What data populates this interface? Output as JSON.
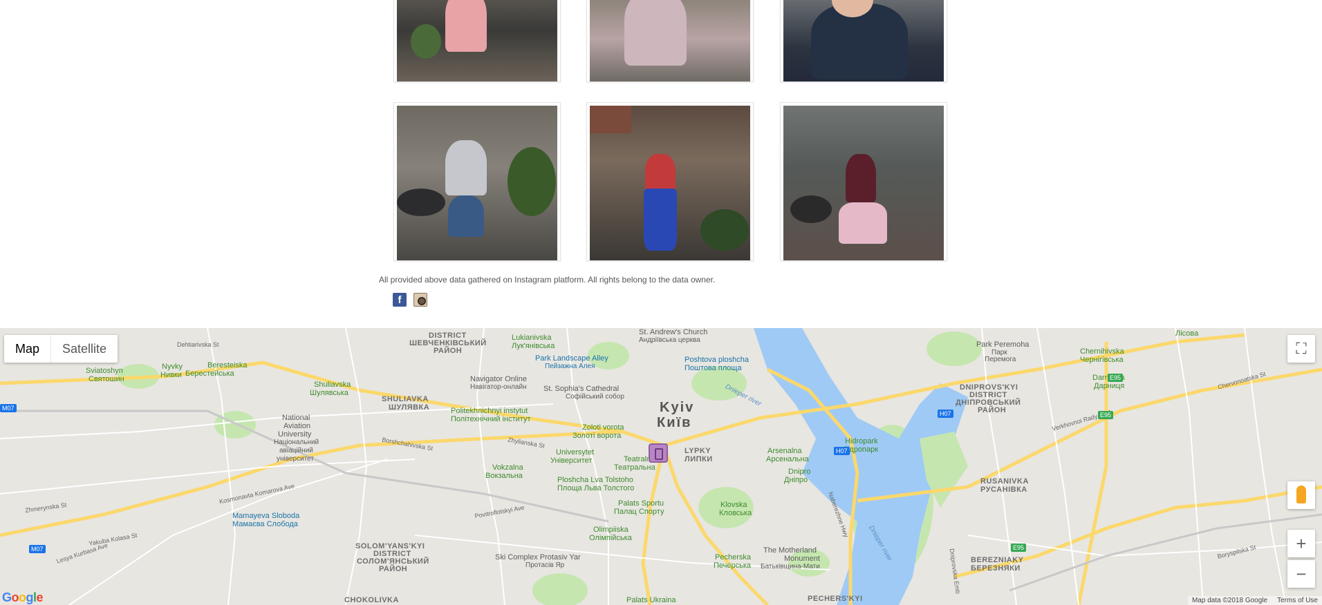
{
  "disclaimer": "All provided above data gathered on Instagram platform. All rights belong to the data owner.",
  "social": {
    "facebook_glyph": "f"
  },
  "map": {
    "type_map": "Map",
    "type_satellite": "Satellite",
    "attribution": "Map data ©2018 Google",
    "terms": "Terms of Use",
    "logo": [
      "G",
      "o",
      "o",
      "g",
      "l",
      "e"
    ],
    "labels": {
      "shevchenkivskyi_1": "DISTRICT",
      "shevchenkivskyi_2": "ШЕВЧЕНКІВСЬКИЙ",
      "shevchenkivskyi_3": "РАЙОН",
      "lukianivska_en": "Lukianivska",
      "lukianivska_ua": "Лук'янівська",
      "st_andrews_en": "St. Andrew's Church",
      "st_andrews_ua": "Андріївська церква",
      "park_landscape_en": "Park Landscape Alley",
      "park_landscape_ua": "Пейзажна Алея",
      "poshtova_en": "Poshtova ploshcha",
      "poshtova_ua": "Поштова площа",
      "park_peremoha_en": "Park Peremoha",
      "park_peremoha_ua1": "Парк",
      "park_peremoha_ua2": "Перемога",
      "chernihivska_en": "Chernihivska",
      "chernihivska_ua": "Чернігівська",
      "lisova_ua": "Лісова",
      "darnytsia_en": "Darnytsia",
      "darnytsia_ua": "Дарниця",
      "dniprovskyi_1": "DNIPROVS'KYI",
      "dniprovskyi_2": "DISTRICT",
      "dniprovskyi_3": "ДНІПРОВСЬКИЙ",
      "dniprovskyi_4": "РАЙОН",
      "sviatoshyn_en": "Sviatoshyn",
      "sviatoshyn_ua": "Святошин",
      "nyvky_en": "Nyvky",
      "nyvky_ua": "Нивки",
      "beresteiska_en": "Beresteiska",
      "beresteiska_ua": "Берестейська",
      "shuliavska_en": "Shuliavska",
      "shuliavska_ua": "Шулявська",
      "navigator_en": "Navigator Online",
      "navigator_ua": "Навігатор-онлайн",
      "st_sophia_en": "St. Sophia's Cathedral",
      "st_sophia_ua": "Софійський собор",
      "shuliavka_en": "SHULIAVKA",
      "shuliavka_ua": "ШУЛЯВКА",
      "polytech_en": "Politekhnichnyi instytut",
      "polytech_ua": "Політехнічний інститут",
      "kyiv_en": "Kyiv",
      "kyiv_ua": "Київ",
      "zoloti_en": "Zoloti vorota",
      "zoloti_ua": "Золоті ворота",
      "lypky_en": "LYPKY",
      "lypky_ua": "ЛИПКИ",
      "national_aviation_1": "National",
      "national_aviation_2": "Aviation",
      "national_aviation_3": "University",
      "national_aviation_4": "Національний",
      "national_aviation_5": "авіаційний",
      "national_aviation_6": "університет",
      "universytet_en": "Universytet",
      "universytet_ua": "Університет",
      "teatralna_en": "Teatralna",
      "teatralna_ua": "Театральна",
      "arsenalna_en": "Arsenalna",
      "arsenalna_ua": "Арсенальна",
      "hidropark_en": "Hidropark",
      "hidropark_ua": "Гідропарк",
      "vokzalna_en": "Vokzalna",
      "vokzalna_ua": "Вокзальна",
      "ploshcha_lva_en": "Ploshcha Lva Tolstoho",
      "ploshcha_lva_ua": "Площа Льва Толстого",
      "dnipro_en": "Dnipro",
      "dnipro_ua": "Дніпро",
      "rusanivka_en": "RUSANIVKA",
      "rusanivka_ua": "РУСАНІВКА",
      "mamayeva_en": "Mamayeva Sloboda",
      "mamayeva_ua": "Мамаєва Слобода",
      "palats_sportu_en": "Palats Sportu",
      "palats_sportu_ua": "Палац Спорту",
      "klovska_en": "Klovska",
      "klovska_ua": "Кловська",
      "olimpiiska_en": "Olimpiiska",
      "olimpiiska_ua": "Олімпійська",
      "solomianskyi_1": "SOLOM'YANS'KYI",
      "solomianskyi_2": "DISTRICT",
      "solomianskyi_3": "СОЛОМ'ЯНСЬКИЙ",
      "solomianskyi_4": "РАЙОН",
      "motherland_1": "The Motherland",
      "motherland_2": "Monument",
      "motherland_3": "Батьківщина-Мати",
      "pecherska_en": "Pecherska",
      "pecherska_ua": "Печерська",
      "ski_complex_en": "Ski Complex Protasiv Yar",
      "ski_complex_ua": "Протасів Яр",
      "berezniaky_en": "BEREZNIAKY",
      "berezniaky_ua": "БЕРЕЗНЯКИ",
      "chokolivka": "CHOKOLIVKA",
      "pecherskyi": "PECHERS'KYI",
      "palats_ukraina": "Palats Ukraina",
      "dnieper_river_1": "Dnieper river",
      "dnieper_river_2": "Dnieper river",
      "naberezhne": "Naberezhne Hwy",
      "dniprovska_emb": "Dniprovska Emb",
      "hw_m07a": "M07",
      "hw_m07b": "M07",
      "hw_h07a": "H07",
      "hw_h07b": "H07",
      "hw_e95a": "E95",
      "hw_e95b": "E95",
      "hw_e95c": "E95",
      "road_dehtiarivska": "Dehtiarivska St",
      "road_borshchahivska": "Borshchahivska St",
      "road_zhylianska": "Zhylianska St",
      "road_zhmerynska": "Zhmerynska St",
      "road_kosmonavta": "Kosmonavta Komarova Ave",
      "road_lesia": "Lesya Kurbasa Ave",
      "road_verkhovnoi": "Verkhovnoi Rady Blvd",
      "road_boryspilska": "Boryspilska St",
      "road_yakuba": "Yakuba Kolasa St",
      "road_povitroflotskyi": "Povitroflotskyi Ave",
      "road_chervonoatska": "Chervonoatska St"
    }
  }
}
